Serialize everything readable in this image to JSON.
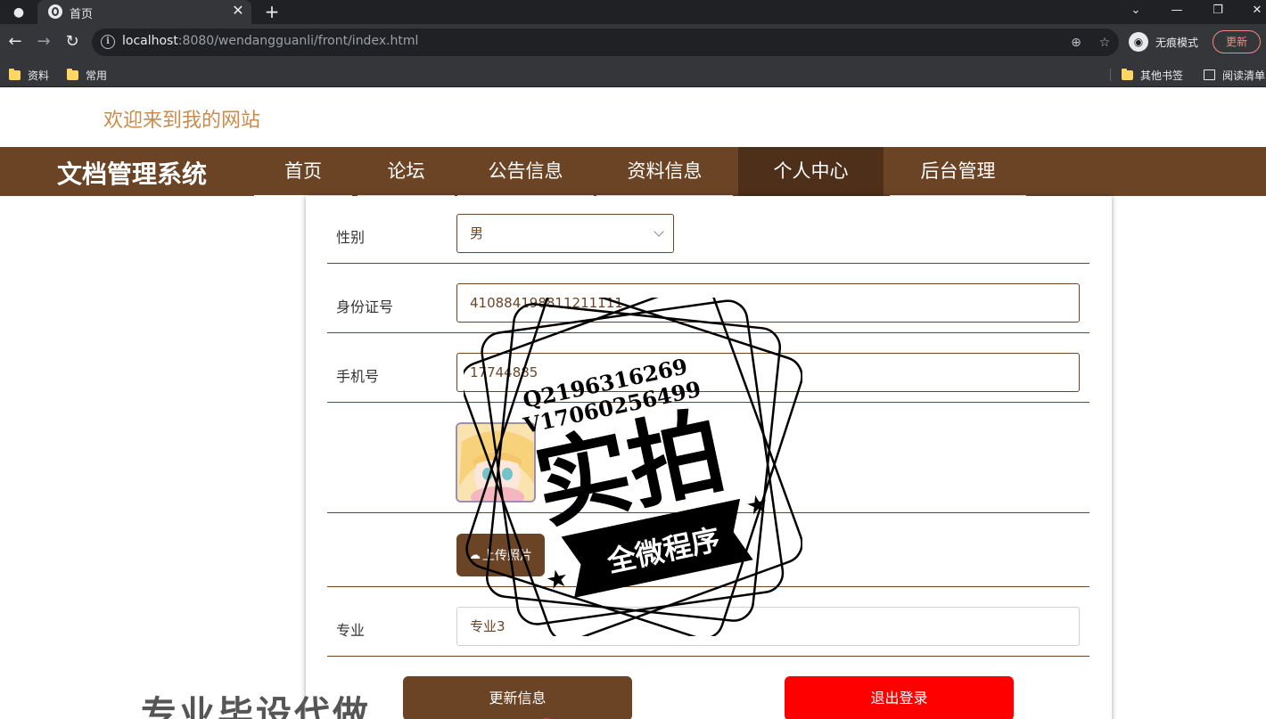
{
  "browser": {
    "tab_title": "首页",
    "url_host": "localhost",
    "url_rest": ":8080/wendangguanli/front/index.html",
    "incognito_label": "无痕模式",
    "update_label": "更新",
    "bookmarks": [
      "资料",
      "常用"
    ],
    "bookmarks_right": [
      "其他书签",
      "阅读清单"
    ]
  },
  "site": {
    "welcome": "欢迎来到我的网站",
    "brand": "文档管理系统",
    "nav": [
      {
        "label": "首页"
      },
      {
        "label": "论坛"
      },
      {
        "label": "公告信息"
      },
      {
        "label": "资料信息"
      },
      {
        "label": "个人中心"
      },
      {
        "label": "后台管理"
      }
    ],
    "active_nav": "个人中心"
  },
  "form": {
    "gender_label": "性别",
    "gender_value": "男",
    "id_label": "身份证号",
    "id_value": "410884198811211111",
    "phone_label": "手机号",
    "phone_value": "17744885",
    "upload_label": "上传照片",
    "major_label": "专业",
    "major_value": "专业3",
    "update_button": "更新信息",
    "logout_button": "退出登录"
  },
  "overlays": {
    "stamp_line1": "Q2196316269",
    "stamp_line2": "V17060256499",
    "stamp_main": "实拍",
    "stamp_ribbon": "全微程序",
    "bottom_watermark": "专业毕设代做"
  },
  "colors": {
    "brand_brown": "#6b4426",
    "active_nav": "#4e2f1a",
    "welcome_text": "#c98b4a",
    "logout_red": "#ff0000"
  }
}
